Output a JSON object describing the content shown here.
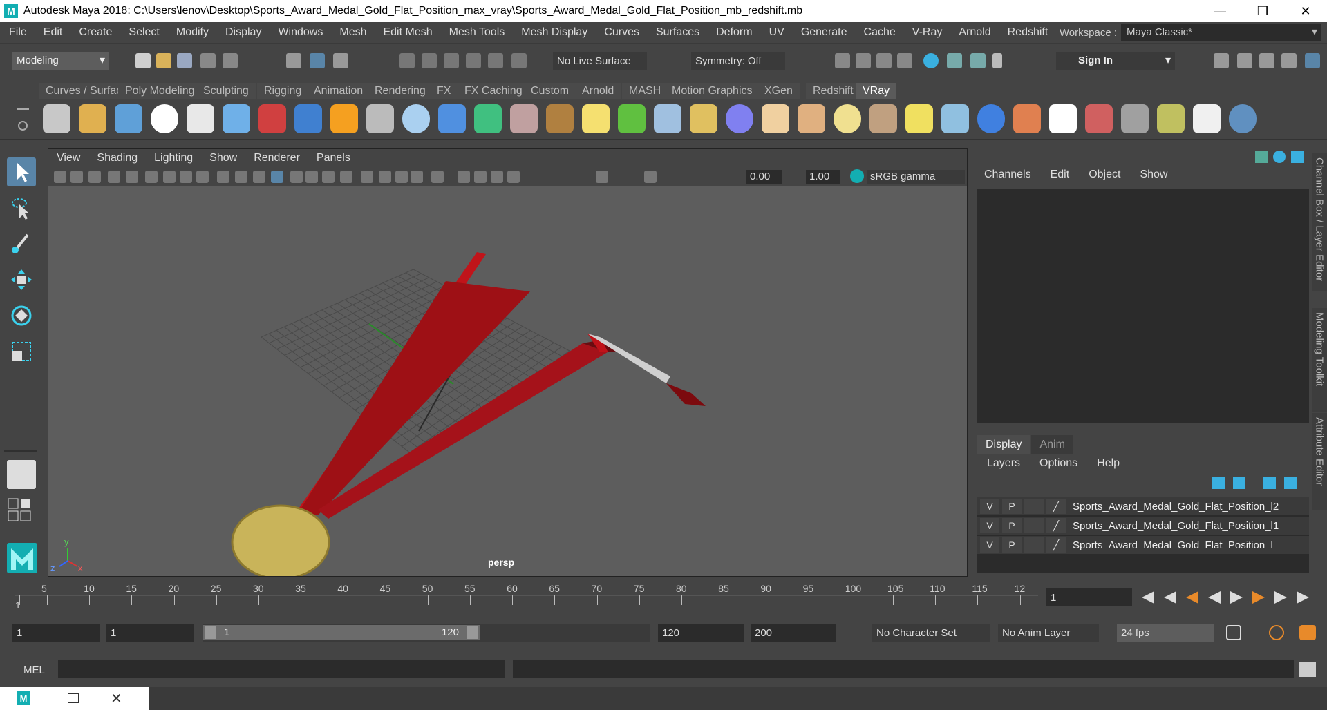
{
  "titlebar": {
    "title": "Autodesk Maya 2018: C:\\Users\\lenov\\Desktop\\Sports_Award_Medal_Gold_Flat_Position_max_vray\\Sports_Award_Medal_Gold_Flat_Position_mb_redshift.mb",
    "app_letter": "M",
    "minimize": "—",
    "restore": "❐",
    "close": "✕"
  },
  "menubar": [
    "File",
    "Edit",
    "Create",
    "Select",
    "Modify",
    "Display",
    "Windows",
    "Mesh",
    "Edit Mesh",
    "Mesh Tools",
    "Mesh Display",
    "Curves",
    "Surfaces",
    "Deform",
    "UV",
    "Generate",
    "Cache",
    "V-Ray",
    "Arnold",
    "Redshift"
  ],
  "workspace": {
    "label": "Workspace :",
    "value": "Maya Classic*"
  },
  "status": {
    "mode": "Modeling",
    "live_surface": "No Live Surface",
    "symmetry": "Symmetry: Off",
    "sign_in": "Sign In"
  },
  "shelf_tabs": [
    "Curves / Surfaces",
    "Poly Modeling",
    "Sculpting",
    "Rigging",
    "Animation",
    "Rendering",
    "FX",
    "FX Caching",
    "Custom",
    "Arnold",
    "MASH",
    "Motion Graphics",
    "XGen",
    "Redshift",
    "VRay"
  ],
  "shelf_active": "VRay",
  "viewport": {
    "menu": [
      "View",
      "Shading",
      "Lighting",
      "Show",
      "Renderer",
      "Panels"
    ],
    "exposure": "0.00",
    "gamma": "1.00",
    "color_space": "sRGB gamma",
    "camera": "persp",
    "axis_x": "x",
    "axis_y": "y",
    "axis_z": "z"
  },
  "channel_box": {
    "menu": [
      "Channels",
      "Edit",
      "Object",
      "Show"
    ],
    "side_tabs": [
      "Channel Box / Layer Editor",
      "Modeling Toolkit",
      "Attribute Editor"
    ]
  },
  "layers": {
    "tabs": [
      "Display",
      "Anim"
    ],
    "menu": [
      "Layers",
      "Options",
      "Help"
    ],
    "visible_flag": "V",
    "playback_flag": "P",
    "rows": [
      "Sports_Award_Medal_Gold_Flat_Position_l2",
      "Sports_Award_Medal_Gold_Flat_Position_l1",
      "Sports_Award_Medal_Gold_Flat_Position_l"
    ]
  },
  "timeline": {
    "ticks": [
      "1",
      "5",
      "10",
      "15",
      "20",
      "25",
      "30",
      "35",
      "40",
      "45",
      "50",
      "55",
      "60",
      "65",
      "70",
      "75",
      "80",
      "85",
      "90",
      "95",
      "100",
      "105",
      "110",
      "115",
      "12"
    ],
    "current_frame": "1"
  },
  "range": {
    "start": "1",
    "playback_start": "1",
    "slider_start": "1",
    "slider_end": "120",
    "playback_end": "120",
    "end": "200",
    "character_set": "No Character Set",
    "anim_layer": "No Anim Layer",
    "fps": "24 fps"
  },
  "cmdline": {
    "label": "MEL"
  },
  "colors": {
    "accent": "#5985a8",
    "ribbon": "#8e0d0d",
    "medal": "#c9b45a"
  }
}
